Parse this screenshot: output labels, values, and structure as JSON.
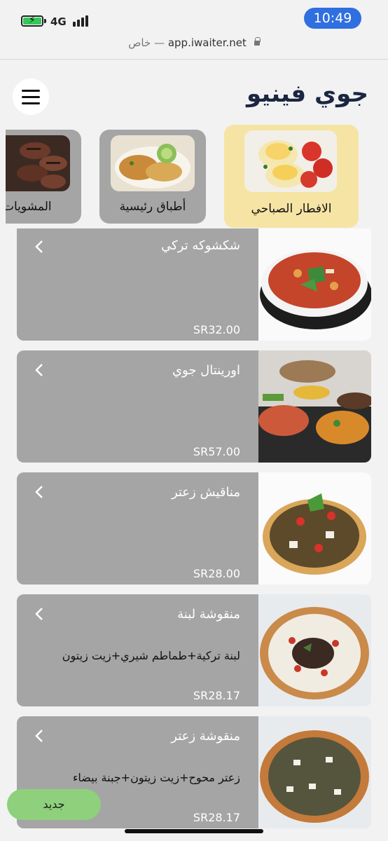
{
  "status_bar": {
    "time": "10:49",
    "network": "4G"
  },
  "browser": {
    "url": "app.iwaiter.net",
    "privacy": "خاص"
  },
  "header": {
    "title": "جوي فينيو"
  },
  "categories": [
    {
      "label": "الافطار الصباحي",
      "active": true
    },
    {
      "label": "أطباق رئيسية",
      "active": false
    },
    {
      "label": "المشويات",
      "active": false
    }
  ],
  "items": [
    {
      "name": "شكشوكه تركي",
      "description": "",
      "price": "SR32.00"
    },
    {
      "name": "اورينتال جوي",
      "description": "",
      "price": "SR57.00"
    },
    {
      "name": "مناقيش زعتر",
      "description": "",
      "price": "SR28.00"
    },
    {
      "name": "منقوشة لبنة",
      "description": "لبنة تركية+طماطم شيري+زيت زيتون",
      "price": "SR28.17"
    },
    {
      "name": "منقوشة زعتر",
      "description": "زعتر محوح+زيت زيتون+جبنة بيضاء",
      "price": "SR28.17"
    }
  ],
  "floating_button": {
    "label": "جديد"
  },
  "colors": {
    "accent_blue": "#2f6fe0",
    "active_category": "#f5e4a3",
    "card_gray": "#a5a5a5",
    "new_button": "#8ed07c",
    "title": "#1b2640"
  }
}
